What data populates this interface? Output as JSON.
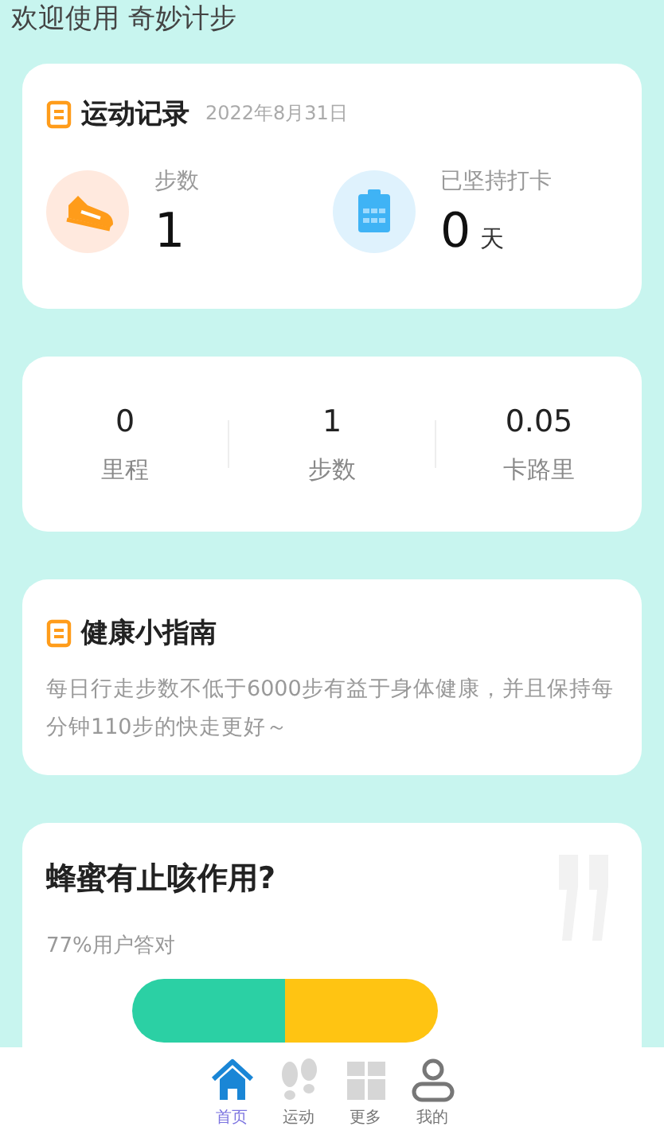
{
  "welcome": "欢迎使用 奇妙计步",
  "record": {
    "title": "运动记录",
    "date": "2022年8月31日",
    "stats": [
      {
        "kind": "shoe",
        "label": "步数",
        "value": "1"
      },
      {
        "kind": "calendar",
        "label": "已坚持打卡",
        "value": "0",
        "unit": "天"
      }
    ]
  },
  "summary": [
    {
      "value": "0",
      "label": "里程"
    },
    {
      "value": "1",
      "label": "步数"
    },
    {
      "value": "0.05",
      "label": "卡路里"
    }
  ],
  "guide": {
    "title": "健康小指南",
    "text": "每日行走步数不低于6000步有益于身体健康，并且保持每分钟110步的快走更好～"
  },
  "quiz": {
    "question": "蜂蜜有止咳作用?",
    "stat": "77%用户答对"
  },
  "tabs": [
    {
      "kind": "home",
      "label": "首页",
      "selected": true
    },
    {
      "kind": "steps",
      "label": "运动",
      "selected": false
    },
    {
      "kind": "grid",
      "label": "更多",
      "selected": false
    },
    {
      "kind": "person",
      "label": "我的",
      "selected": false
    }
  ]
}
